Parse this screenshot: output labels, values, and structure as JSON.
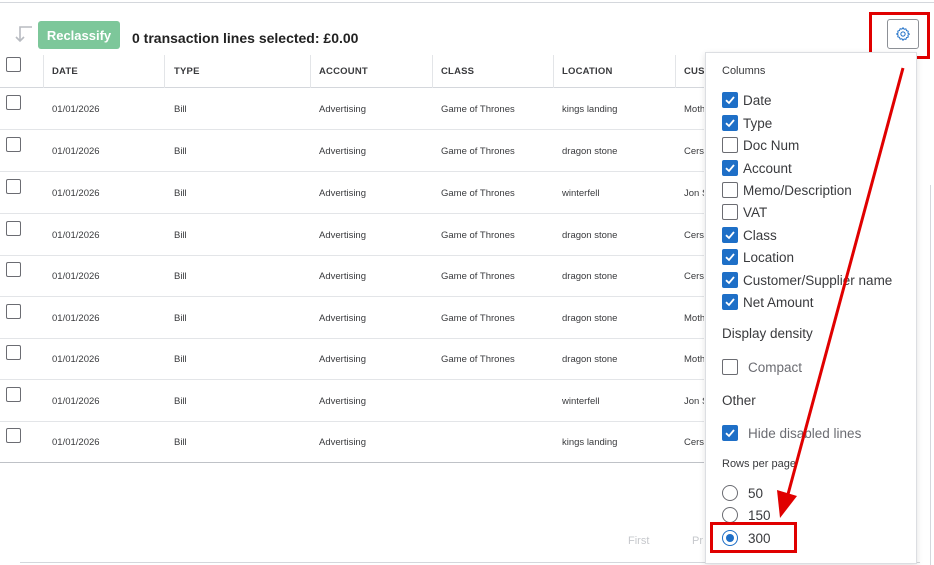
{
  "toolbar": {
    "reclassify_label": "Reclassify",
    "selection_summary": "0 transaction lines selected: £0.00"
  },
  "table": {
    "columns": [
      "DATE",
      "TYPE",
      "ACCOUNT",
      "CLASS",
      "LOCATION",
      "CUS"
    ],
    "rows": [
      {
        "date": "01/01/2026",
        "type": "Bill",
        "account": "Advertising",
        "class": "Game of Thrones",
        "location": "kings landing",
        "customer": "Moth"
      },
      {
        "date": "01/01/2026",
        "type": "Bill",
        "account": "Advertising",
        "class": "Game of Thrones",
        "location": "dragon stone",
        "customer": "Cers"
      },
      {
        "date": "01/01/2026",
        "type": "Bill",
        "account": "Advertising",
        "class": "Game of Thrones",
        "location": "winterfell",
        "customer": "Jon S"
      },
      {
        "date": "01/01/2026",
        "type": "Bill",
        "account": "Advertising",
        "class": "Game of Thrones",
        "location": "dragon stone",
        "customer": "Cers"
      },
      {
        "date": "01/01/2026",
        "type": "Bill",
        "account": "Advertising",
        "class": "Game of Thrones",
        "location": "dragon stone",
        "customer": "Cers"
      },
      {
        "date": "01/01/2026",
        "type": "Bill",
        "account": "Advertising",
        "class": "Game of Thrones",
        "location": "dragon stone",
        "customer": "Moth"
      },
      {
        "date": "01/01/2026",
        "type": "Bill",
        "account": "Advertising",
        "class": "Game of Thrones",
        "location": "dragon stone",
        "customer": "Moth"
      },
      {
        "date": "01/01/2026",
        "type": "Bill",
        "account": "Advertising",
        "class": "",
        "location": "winterfell",
        "customer": "Jon S"
      },
      {
        "date": "01/01/2026",
        "type": "Bill",
        "account": "Advertising",
        "class": "",
        "location": "kings landing",
        "customer": "Cers"
      }
    ]
  },
  "pagination": {
    "first_label": "First",
    "prev_label": "Pr"
  },
  "settings_panel": {
    "columns_heading": "Columns",
    "columns": [
      {
        "label": "Date",
        "checked": true
      },
      {
        "label": "Type",
        "checked": true
      },
      {
        "label": "Doc Num",
        "checked": false
      },
      {
        "label": "Account",
        "checked": true
      },
      {
        "label": "Memo/Description",
        "checked": false
      },
      {
        "label": "VAT",
        "checked": false
      },
      {
        "label": "Class",
        "checked": true
      },
      {
        "label": "Location",
        "checked": true
      },
      {
        "label": "Customer/Supplier name",
        "checked": true
      },
      {
        "label": "Net Amount",
        "checked": true
      }
    ],
    "density_heading": "Display density",
    "compact_label": "Compact",
    "compact_checked": false,
    "other_heading": "Other",
    "hide_disabled_label": "Hide disabled lines",
    "hide_disabled_checked": true,
    "rows_per_page_heading": "Rows per page",
    "rows_per_page_options": [
      "50",
      "150",
      "300"
    ],
    "rows_per_page_selected": "300"
  },
  "colors": {
    "accent_blue": "#1e6fc7",
    "reclassify_green": "#7dc79a",
    "annotation_red": "#e00000"
  }
}
